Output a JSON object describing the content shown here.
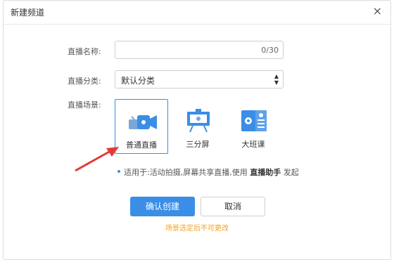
{
  "dialog": {
    "title": "新建频道",
    "close_icon": "close-icon"
  },
  "form": {
    "name_label": "直播名称:",
    "name_value": "",
    "name_counter": "0/30",
    "category_label": "直播分类:",
    "category_value": "默认分类",
    "scene_label": "直播场景:"
  },
  "scenes": [
    {
      "label": "普通直播",
      "icon": "video-camera-icon",
      "selected": true
    },
    {
      "label": "三分屏",
      "icon": "presentation-board-icon",
      "selected": false
    },
    {
      "label": "大班课",
      "icon": "class-board-icon",
      "selected": false
    }
  ],
  "hint": {
    "prefix": "适用于:活动拍摄,屏幕共享直播,使用",
    "bold": "直播助手",
    "suffix": "发起"
  },
  "buttons": {
    "confirm": "确认创建",
    "cancel": "取消"
  },
  "warning": "场景选定后不可更改",
  "colors": {
    "accent": "#3a8ee6",
    "warning": "#f0a020",
    "arrow": "#e53935"
  }
}
